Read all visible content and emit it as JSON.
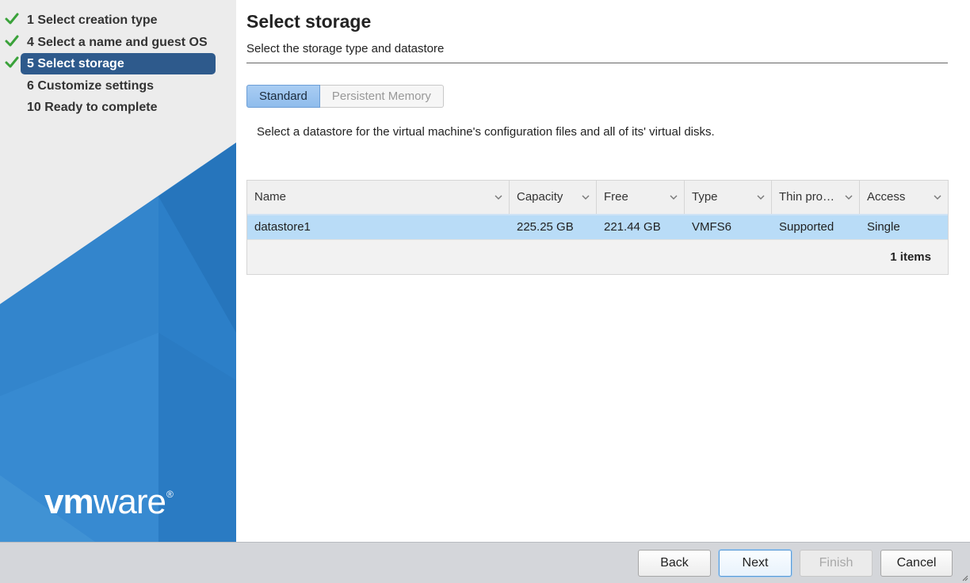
{
  "sidebar": {
    "steps": [
      {
        "label": "1 Select creation type",
        "done": true
      },
      {
        "label": "4 Select a name and guest OS",
        "done": true
      },
      {
        "label": "5 Select storage",
        "done": true,
        "active": true
      },
      {
        "label": "6 Customize settings",
        "done": false
      },
      {
        "label": "10 Ready to complete",
        "done": false
      }
    ],
    "brand": {
      "vm": "vm",
      "ware": "ware",
      "reg": "®"
    }
  },
  "main": {
    "title": "Select storage",
    "subtitle": "Select the storage type and datastore",
    "tabs": [
      {
        "label": "Standard",
        "selected": true
      },
      {
        "label": "Persistent Memory",
        "selected": false
      }
    ],
    "description": "Select a datastore for the virtual machine's configuration files and all of its' virtual disks.",
    "table": {
      "columns": [
        "Name",
        "Capacity",
        "Free",
        "Type",
        "Thin pro…",
        "Access"
      ],
      "rows": [
        {
          "name": "datastore1",
          "capacity": "225.25 GB",
          "free": "221.44 GB",
          "type": "VMFS6",
          "thin": "Supported",
          "access": "Single"
        }
      ],
      "count": "1 items"
    }
  },
  "footer": {
    "back": "Back",
    "next": "Next",
    "finish": "Finish",
    "cancel": "Cancel"
  },
  "colors": {
    "check": "#3aa23a",
    "active_step": "#2e5a8c",
    "selected_row": "#b9dcf7",
    "brand_blue": "#2c7fc8"
  }
}
